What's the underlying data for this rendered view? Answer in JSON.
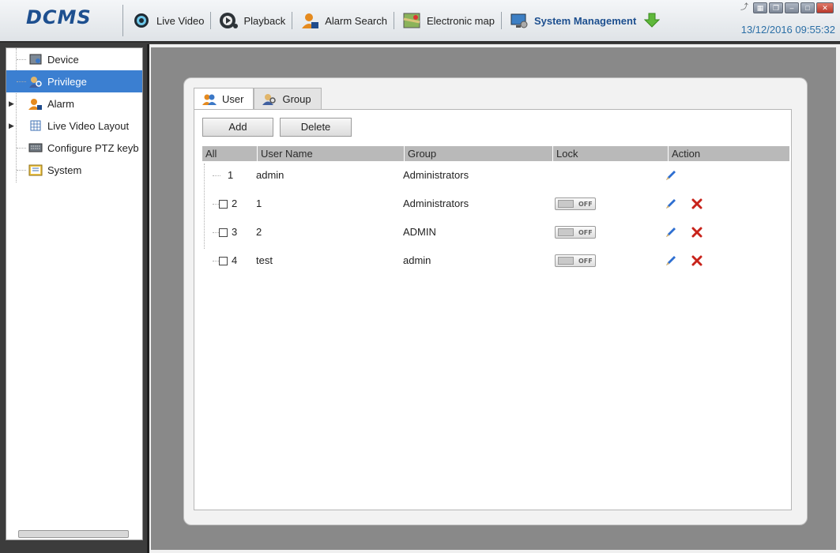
{
  "app": {
    "logo": "DCMS",
    "datetime": "13/12/2016 09:55:32"
  },
  "nav": [
    {
      "label": "Live Video",
      "icon": "eye-icon"
    },
    {
      "label": "Playback",
      "icon": "playback-icon"
    },
    {
      "label": "Alarm Search",
      "icon": "alarm-person-icon"
    },
    {
      "label": "Electronic map",
      "icon": "map-icon"
    },
    {
      "label": "System Management",
      "icon": "monitor-gear-icon"
    }
  ],
  "sidebar": {
    "items": [
      {
        "label": "Device",
        "icon": "device-icon"
      },
      {
        "label": "Privilege",
        "icon": "privilege-icon"
      },
      {
        "label": "Alarm",
        "icon": "alarm-icon"
      },
      {
        "label": "Live Video Layout",
        "icon": "layout-icon"
      },
      {
        "label": "Configure PTZ keyb",
        "icon": "keyboard-icon"
      },
      {
        "label": "System",
        "icon": "system-icon"
      }
    ]
  },
  "tabs": [
    {
      "label": "User",
      "icon": "users-icon"
    },
    {
      "label": "Group",
      "icon": "group-icon"
    }
  ],
  "toolbar": {
    "add_label": "Add",
    "delete_label": "Delete"
  },
  "table": {
    "headers": [
      "All",
      "User Name",
      "Group",
      "Lock",
      "Action"
    ],
    "rows": [
      {
        "index": "1",
        "name": "admin",
        "group": "Administrators",
        "lock": "",
        "checkbox": false,
        "deletable": false
      },
      {
        "index": "2",
        "name": "1",
        "group": "Administrators",
        "lock": "OFF",
        "checkbox": true,
        "deletable": true
      },
      {
        "index": "3",
        "name": "2",
        "group": "ADMIN",
        "lock": "OFF",
        "checkbox": true,
        "deletable": true
      },
      {
        "index": "4",
        "name": "test",
        "group": "admin",
        "lock": "OFF",
        "checkbox": true,
        "deletable": true
      }
    ]
  },
  "colors": {
    "accent": "#1d4f8f",
    "selected": "#3b7fd1",
    "delete": "#c8231b"
  }
}
